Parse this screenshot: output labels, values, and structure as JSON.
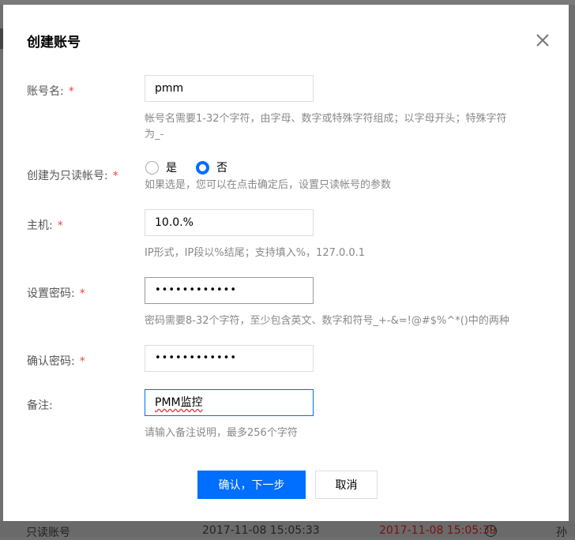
{
  "background": {
    "bottom_row": {
      "col1": "只读账号",
      "col2": "2017-11-08 15:05:33",
      "col3": "2017-11-08 15:05:39",
      "col4": "孙"
    }
  },
  "dialog": {
    "title": "创建账号",
    "close_icon": "close-icon",
    "fields": {
      "account_name": {
        "label": "账号名:",
        "required": "*",
        "value": "pmm",
        "help_line1": "帐号名需要1-32个字符，由字母、数字或特殊字符组成；以字母开头；特殊字符",
        "help_line2": "为_-"
      },
      "readonly": {
        "label": "创建为只读帐号:",
        "required": "*",
        "option_yes": "是",
        "option_no": "否",
        "selected": "否",
        "help": "如果选是，您可以在点击确定后，设置只读帐号的参数"
      },
      "host": {
        "label": "主机:",
        "required": "*",
        "value": "10.0.%",
        "help": "IP形式，IP段以%结尾；支持填入%，127.0.0.1"
      },
      "password": {
        "label": "设置密码:",
        "required": "*",
        "value": "••••••••••••",
        "help": "密码需要8-32个字符，至少包含英文、数字和符号_+-&=!@#$%^*()中的两种"
      },
      "confirm_password": {
        "label": "确认密码:",
        "required": "*",
        "value": "••••••••••••"
      },
      "remark": {
        "label": "备注:",
        "value": "PMM监控",
        "help": "请输入备注说明，最多256个字符"
      }
    },
    "buttons": {
      "confirm": "确认，下一步",
      "cancel": "取消"
    },
    "colors": {
      "primary": "#006eff",
      "required": "#e54545"
    }
  }
}
